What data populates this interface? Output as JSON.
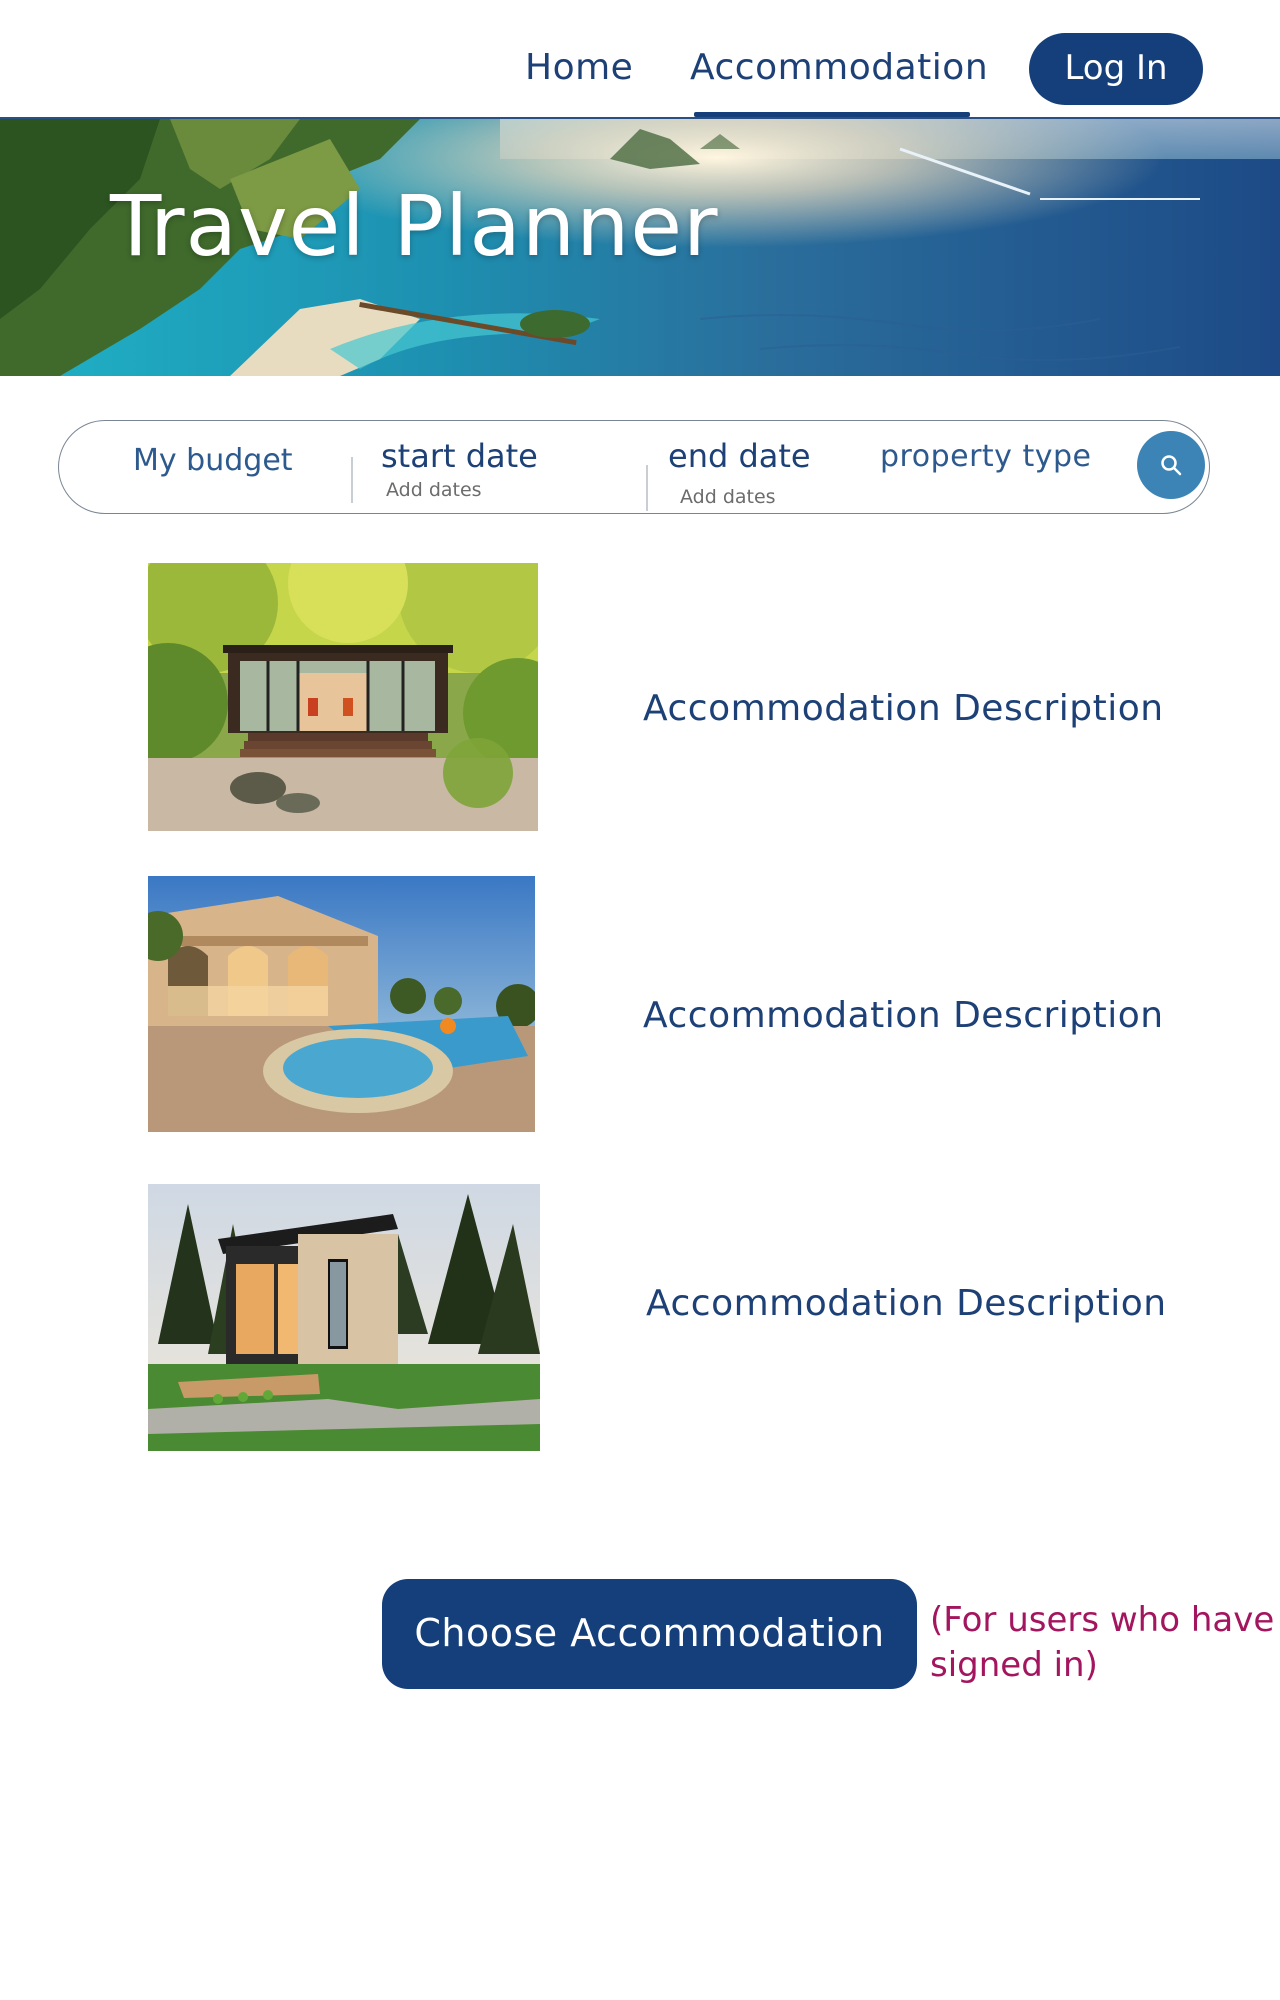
{
  "nav": {
    "home_label": "Home",
    "accommodation_label": "Accommodation",
    "login_label": "Log In",
    "active": "Accommodation"
  },
  "hero": {
    "title": "Travel Planner"
  },
  "search": {
    "budget_label": "My budget",
    "start_label": "start date",
    "start_placeholder": "Add dates",
    "end_label": "end date",
    "end_placeholder": "Add dates",
    "property_type_label": "property type",
    "search_icon": "search-icon"
  },
  "listings": [
    {
      "description": "Accommodation Description",
      "image": "glass-house-in-garden-photo"
    },
    {
      "description": "Accommodation Description",
      "image": "villa-with-pool-photo"
    },
    {
      "description": "Accommodation Description",
      "image": "modern-tiny-house-photo"
    }
  ],
  "cta": {
    "choose_label": "Choose Accommodation",
    "note": "(For users who have signed in)"
  },
  "colors": {
    "brand_navy": "#153f7a",
    "text_blue": "#1d4177",
    "search_button": "#3b84b5",
    "note_magenta": "#a3155e"
  }
}
